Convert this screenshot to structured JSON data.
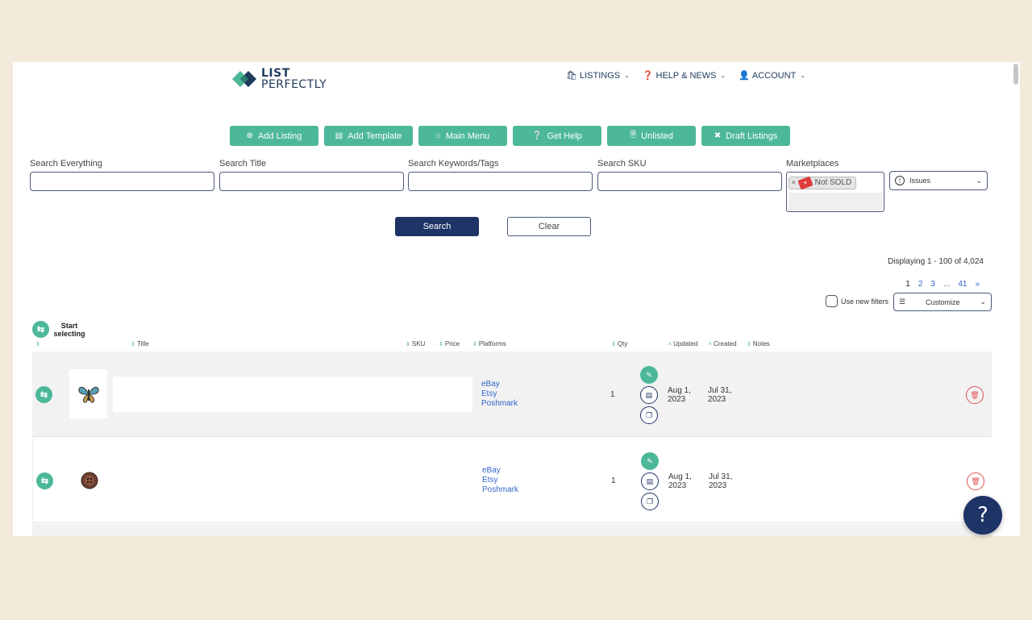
{
  "brand": {
    "line1": "LIST",
    "line2": "PERFECTLY"
  },
  "nav": {
    "listings": "LISTINGS",
    "help": "HELP & NEWS",
    "account": "ACCOUNT"
  },
  "toolbar": {
    "add_listing": "Add Listing",
    "add_template": "Add Template",
    "main_menu": "Main Menu",
    "get_help": "Get Help",
    "unlisted": "Unlisted",
    "draft_listings": "Draft Listings"
  },
  "search": {
    "everything_label": "Search Everything",
    "title_label": "Search Title",
    "keywords_label": "Search Keywords/Tags",
    "sku_label": "Search SKU",
    "marketplaces_label": "Marketplaces",
    "marketplace_tag": "Not SOLD",
    "issues": "Issues",
    "search_btn": "Search",
    "clear_btn": "Clear"
  },
  "results": {
    "displaying": "Displaying 1 - 100 of 4,024",
    "pages": [
      "1",
      "2",
      "3",
      "...",
      "41",
      "»"
    ],
    "use_new_filters": "Use new filters",
    "customize": "Customize",
    "start_selecting": "Start selecting"
  },
  "columns": {
    "title": "Title",
    "sku": "SKU",
    "price": "Price",
    "platforms": "Platforms",
    "qty": "Qty",
    "updated": "Updated",
    "created": "Created",
    "notes": "Notes"
  },
  "rows": [
    {
      "platforms": [
        "eBay",
        "Etsy",
        "Poshmark"
      ],
      "qty": "1",
      "updated": [
        "Aug 1,",
        "2023"
      ],
      "created": [
        "Jul 31,",
        "2023"
      ]
    },
    {
      "platforms": [
        "eBay",
        "Etsy",
        "Poshmark"
      ],
      "qty": "1",
      "updated": [
        "Aug 1,",
        "2023"
      ],
      "created": [
        "Jul 31,",
        "2023"
      ]
    }
  ],
  "help_fab": "?",
  "colors": {
    "accent": "#4db899",
    "navy": "#1e3366",
    "link": "#3366cc",
    "danger": "#e05050"
  }
}
